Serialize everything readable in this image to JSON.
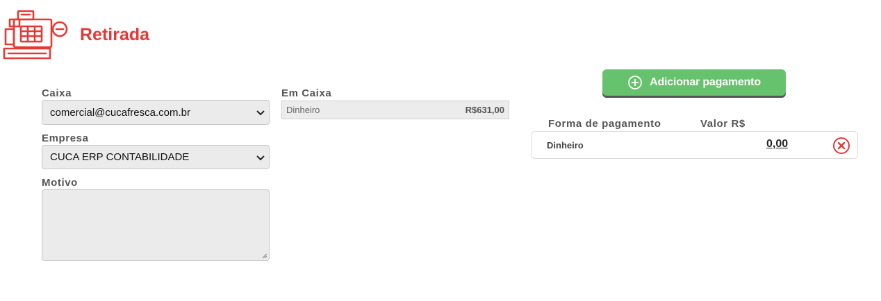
{
  "header": {
    "title": "Retirada",
    "icon": "cash-register-minus-icon",
    "accent": "#e53935"
  },
  "form": {
    "caixa": {
      "label": "Caixa",
      "value": "comercial@cucafresca.com.br"
    },
    "empresa": {
      "label": "Empresa",
      "value": "CUCA ERP CONTABILIDADE"
    },
    "motivo": {
      "label": "Motivo",
      "value": ""
    }
  },
  "em_caixa": {
    "label": "Em Caixa",
    "method": "Dinheiro",
    "amount": "R$631,00"
  },
  "payments": {
    "add_button": "Adicionar pagamento",
    "button_color": "#66c26c",
    "col_method": "Forma de pagamento",
    "col_value": "Valor R$",
    "rows": [
      {
        "method": "Dinheiro",
        "value": "0,00"
      }
    ]
  }
}
